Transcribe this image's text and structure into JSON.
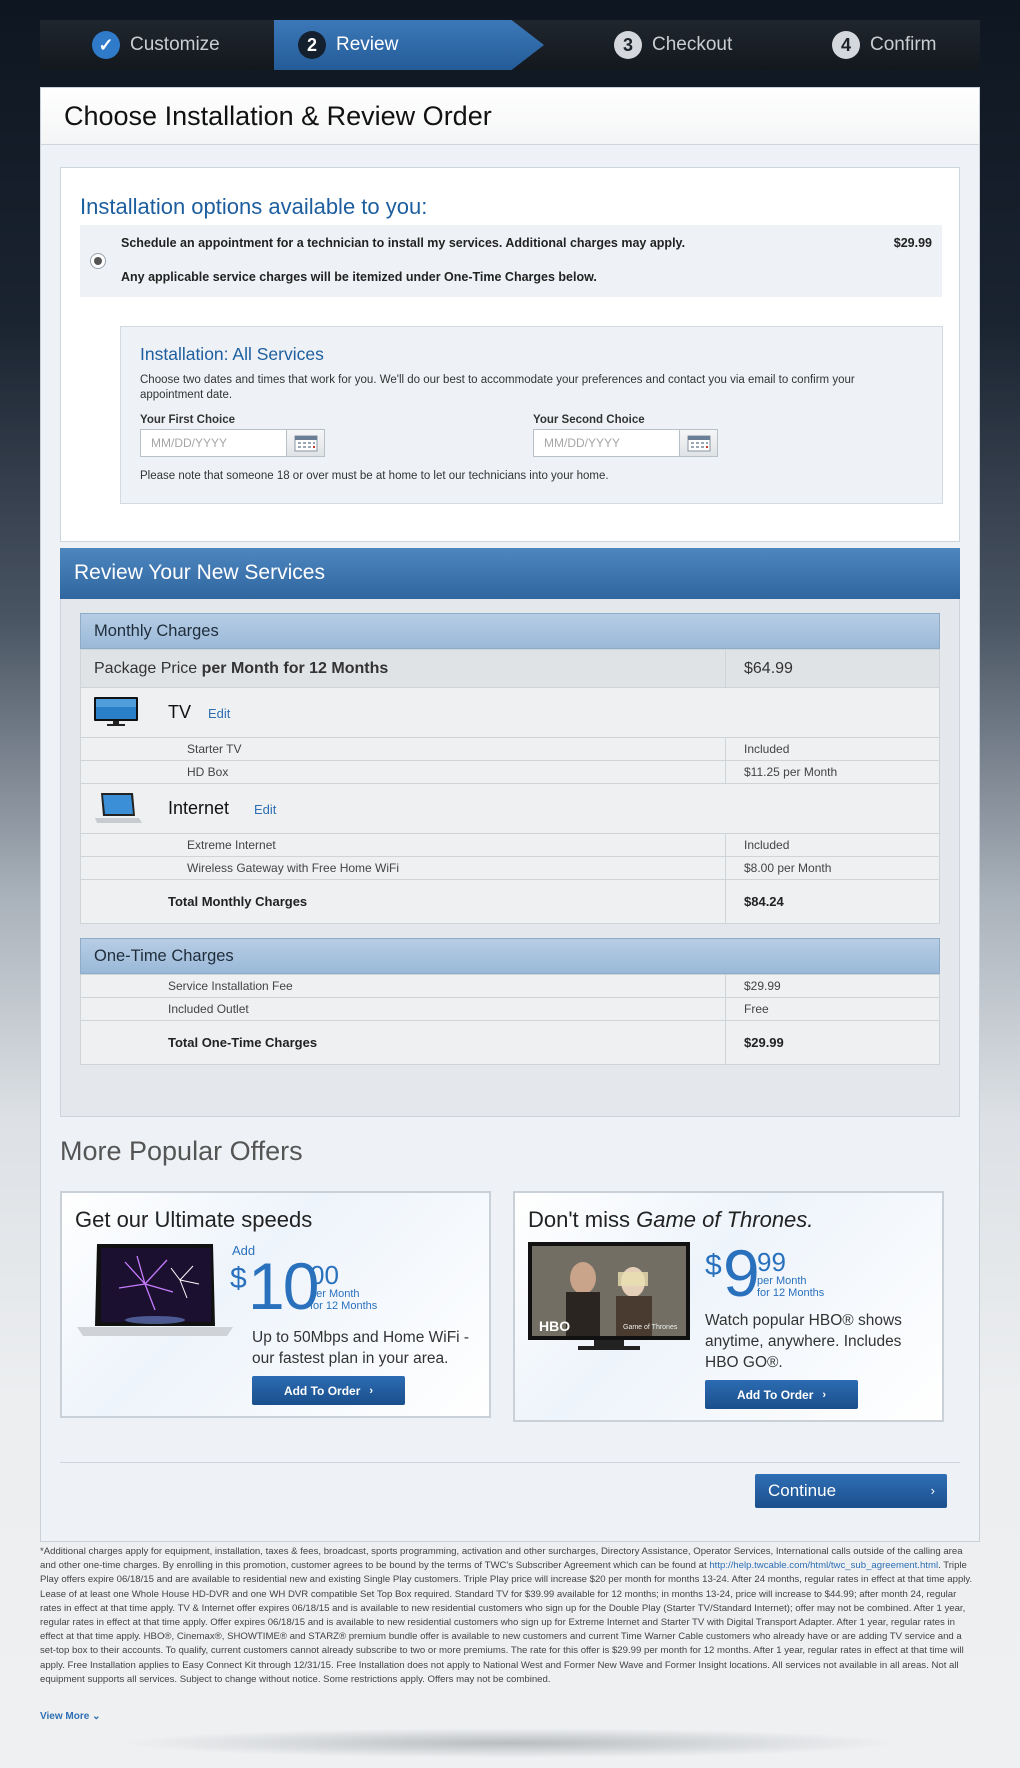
{
  "steps": [
    {
      "num": "✓",
      "label": "Customize"
    },
    {
      "num": "2",
      "label": "Review"
    },
    {
      "num": "3",
      "label": "Checkout"
    },
    {
      "num": "4",
      "label": "Confirm"
    }
  ],
  "page_title": "Choose Installation & Review Order",
  "installation": {
    "title": "Installation options available to you:",
    "option_line1": "Schedule an appointment for a technician to install my services. Additional charges may apply.",
    "option_line2": "Any applicable service charges will be itemized under One-Time Charges below.",
    "option_price": "$29.99",
    "schedule_title": "Installation: All Services",
    "schedule_desc": "Choose two dates and times that work for you. We'll do our best to accommodate your preferences and contact you via email to confirm your appointment date.",
    "first_choice_label": "Your First Choice",
    "second_choice_label": "Your Second Choice",
    "date_placeholder": "MM/DD/YYYY",
    "note": "Please note that someone 18 or over must be at home to let our technicians into your home."
  },
  "review": {
    "title": "Review Your New Services",
    "monthly_head": "Monthly Charges",
    "package_label_pre": "Package Price ",
    "package_label_bold": "per Month for 12 Months",
    "package_price": "$64.99",
    "tv": {
      "name": "TV",
      "edit": "Edit",
      "items": [
        {
          "name": "Starter TV",
          "price": "Included"
        },
        {
          "name": "HD Box",
          "price": "$11.25 per Month"
        }
      ]
    },
    "internet": {
      "name": "Internet",
      "edit": "Edit",
      "items": [
        {
          "name": "Extreme Internet",
          "price": "Included"
        },
        {
          "name": "Wireless Gateway with Free Home WiFi",
          "price": "$8.00 per Month"
        }
      ]
    },
    "total_monthly_label": "Total Monthly Charges",
    "total_monthly": "$84.24",
    "onetime_head": "One-Time Charges",
    "onetime_items": [
      {
        "name": "Service Installation Fee",
        "price": "$29.99"
      },
      {
        "name": "Included Outlet",
        "price": "Free"
      }
    ],
    "total_onetime_label": "Total One-Time Charges",
    "total_onetime": "$29.99"
  },
  "offers": {
    "title": "More Popular Offers",
    "speed": {
      "title": "Get our Ultimate speeds",
      "add": "Add",
      "dollar": "$",
      "whole": "10",
      "cents": "00",
      "per1": "per Month",
      "per2": "for 12 Months",
      "desc1": "Up to 50Mbps and Home WiFi -",
      "desc2": "our fastest plan in your area.",
      "button": "Add To Order"
    },
    "got": {
      "title_pre": "Don't miss ",
      "title_italic": "Game of Thrones.",
      "dollar": "$",
      "whole": "9",
      "cents": "99",
      "per1": "per Month",
      "per2": "for 12 Months",
      "desc1": "Watch popular HBO® shows",
      "desc2": "anytime, anywhere. Includes",
      "desc3": "HBO GO®.",
      "button": "Add To Order",
      "hbo": "HBO",
      "show": "Game of Thrones"
    }
  },
  "continue_label": "Continue",
  "fine_print": {
    "p1": "*Additional charges apply for equipment, installation, taxes & fees, broadcast, sports programming, activation and other surcharges, Directory Assistance, Operator Services, International calls outside of the calling area and other one-time charges. By enrolling in this promotion, customer agrees to be bound by the terms of TWC's Subscriber Agreement which can be found at",
    "link": "http://help.twcable.com/html/twc_sub_agreement.html",
    "p2": ". Triple Play offers expire 06/18/15 and are available to residential new and existing Single Play customers. Triple Play price will increase $20 per month for months 13-24. After 24 months, regular rates in effect at that time apply. Lease of at least one Whole House HD-DVR and one WH DVR compatible Set Top Box required. Standard TV for $39.99 available for 12 months; in months 13-24, price will increase to $44.99; after month 24, regular rates in effect at that time apply. TV & Internet offer expires 06/18/15 and is available to new residential customers who sign up for the Double Play (Starter TV/Standard Internet); offer may not be combined. After 1 year, regular rates in effect at that time apply. Offer expires 06/18/15 and is available to new residential customers who sign up for Extreme Internet and Starter TV with Digital Transport Adapter. After 1 year, regular rates in effect at that time apply. HBO®, Cinemax®, SHOWTIME® and STARZ® premium bundle offer is available to new customers and current Time Warner Cable customers who already have or are adding TV service and a set-top box to their accounts. To qualify, current customers cannot already subscribe to two or more premiums. The rate for this offer is $29.99 per month for 12 months. After 1 year, regular rates in effect at that time will apply. Free Installation applies to Easy Connect Kit through 12/31/15. Free Installation does not apply to National West and Former New Wave and Former Insight locations. All services not available in all areas. Not all equipment supports all services. Subject to change without notice. Some restrictions apply. Offers may not be combined.",
    "view_more": "View More"
  }
}
